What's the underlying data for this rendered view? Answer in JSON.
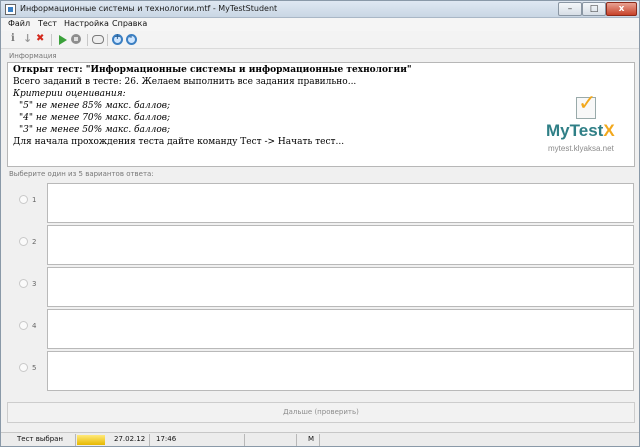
{
  "window": {
    "title": "Информационные системы и технологии.mtf - MyTestStudent",
    "min_glyph": "–",
    "max_glyph": "□",
    "close_glyph": "x"
  },
  "menu": {
    "items": [
      "Файл",
      "Тест",
      "Настройка",
      "Справка"
    ]
  },
  "sections": {
    "info_label": "Информация",
    "answers_label": "Выберите один из 5 вариантов ответа:"
  },
  "info": {
    "line1": "Открыт тест: \"Информационные системы и информационные технологии\"",
    "line2": "Всего заданий в тесте: 26. Желаем выполнить все задания правильно...",
    "line3": "Критерии оценивания:",
    "line4": "\"5\" не менее 85% макс. баллов;",
    "line5": "\"4\" не менее 70% макс. баллов;",
    "line6": "\"3\" не менее 50% макс. баллов;",
    "line7": "Для начала прохождения теста дайте команду Тест -> Начать тест..."
  },
  "logo": {
    "text_main": "MyTest",
    "text_x": "X",
    "url": "mytest.klyaksa.net"
  },
  "answers": {
    "options": [
      "1",
      "2",
      "3",
      "4",
      "5"
    ]
  },
  "next_button": {
    "label": "Дальше (проверить)"
  },
  "status": {
    "state": "Тест выбран",
    "date": "27.02.12",
    "time": "17:46",
    "mode": "M"
  },
  "colors": {
    "accent": "#2f7f86",
    "check": "#f2a81d",
    "play": "#3aa13a",
    "stop": "#d42a1e"
  },
  "icons": [
    "info-icon",
    "arrow-down-icon",
    "stop-cross-icon",
    "play-icon",
    "pause-icon",
    "chat-icon",
    "zoom-in-icon",
    "zoom-out-icon"
  ]
}
